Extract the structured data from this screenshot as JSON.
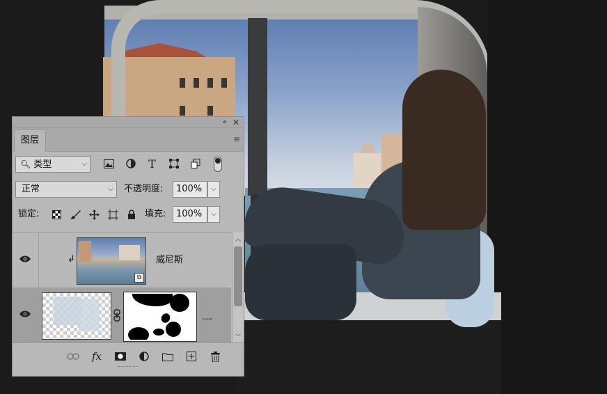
{
  "panel": {
    "collapse_glyph": "«",
    "close_glyph": "✕",
    "tab_label": "图层",
    "menu_glyph": "≡",
    "filter": {
      "kind_label": "类型",
      "icons": [
        "image-filter-icon",
        "adjustment-filter-icon",
        "type-filter-icon",
        "shape-filter-icon",
        "smart-object-filter-icon"
      ]
    },
    "blend_mode": "正常",
    "opacity_label": "不透明度:",
    "opacity_value": "100%",
    "lock_label": "锁定:",
    "lock_icons": [
      "lock-transparent-pixels-icon",
      "lock-image-pixels-icon",
      "lock-position-icon",
      "lock-artboard-icon",
      "lock-all-icon"
    ],
    "fill_label": "填充:",
    "fill_value": "100%",
    "layers": [
      {
        "name": "威尼斯",
        "visible": true,
        "clipped": true,
        "smart_object": true,
        "selected": false
      },
      {
        "name": "",
        "visible": true,
        "clipped": false,
        "has_mask": true,
        "selected": true
      }
    ],
    "bottom_icons": [
      "link-layers-icon",
      "fx-icon",
      "add-mask-icon",
      "adjustment-layer-icon",
      "group-folder-icon",
      "new-layer-icon",
      "delete-icon"
    ],
    "fx_label": "fx"
  }
}
